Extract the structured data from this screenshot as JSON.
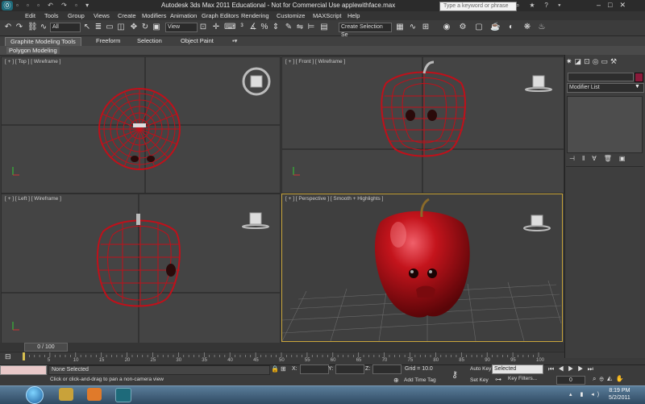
{
  "window": {
    "title": "Autodesk 3ds Max  2011   Educational - Not for Commercial Use    applewithface.max",
    "app_icon": "3ds-max-logo-icon"
  },
  "search": {
    "placeholder": "Type a keyword or phrase"
  },
  "menu": [
    "Edit",
    "Tools",
    "Group",
    "Views",
    "Create",
    "Modifiers",
    "Animation",
    "Graph Editors",
    "Rendering",
    "Customize",
    "MAXScript",
    "Help"
  ],
  "toolbar": {
    "selection_filter": "All",
    "ref_coord": "View",
    "named_selection": "Create Selection Se"
  },
  "ribbon": {
    "tabs": [
      "Graphite Modeling Tools",
      "Freeform",
      "Selection",
      "Object Paint"
    ],
    "subtab": "Polygon Modeling"
  },
  "viewports": {
    "top": "[ + ] [ Top ] [ Wireframe ]",
    "front": "[ + ] [ Front ] [ Wireframe ]",
    "left": "[ + ] [ Left ] [ Wireframe ]",
    "perspective": "[ + ] [ Perspective ] [ Smooth + Highlights ]"
  },
  "command_panel": {
    "modifier_list": "Modifier List",
    "object_color": "#8a1a3a"
  },
  "timeline": {
    "slider": "0 / 100",
    "ticks": [
      "0",
      "5",
      "10",
      "15",
      "20",
      "25",
      "30",
      "35",
      "40",
      "45",
      "50",
      "55",
      "60",
      "65",
      "70",
      "75",
      "80",
      "85",
      "90",
      "95",
      "100"
    ]
  },
  "status": {
    "selection": "None Selected",
    "prompt": "Click or click-and-drag to pan a non-camera view",
    "x_label": "X:",
    "y_label": "Y:",
    "z_label": "Z:",
    "grid": "Grid = 10.0",
    "add_time_tag": "Add Time Tag",
    "auto_key": "Auto Key",
    "set_key": "Set Key",
    "selected": "Selected",
    "key_filters": "Key Filters...",
    "frame": "0"
  },
  "taskbar": {
    "time": "8:19 PM",
    "date": "5/2/2011"
  },
  "colors": {
    "wireframe": "#c0101a",
    "apple": "#b3121a",
    "active_viewport_border": "#c8a43a"
  }
}
